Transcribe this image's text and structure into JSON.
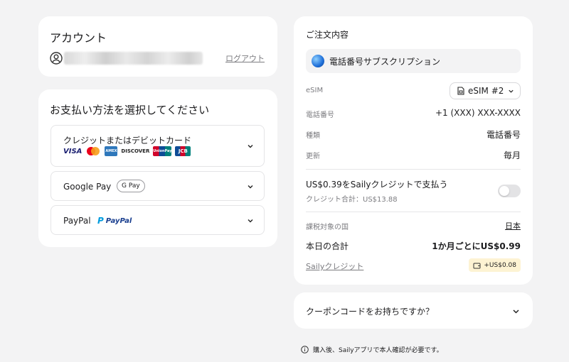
{
  "account": {
    "title": "アカウント",
    "logout": "ログアウト"
  },
  "payment": {
    "title": "お支払い方法を選択してください",
    "methods": [
      {
        "label": "クレジットまたはデビットカード",
        "logos": [
          "VISA",
          "Mastercard",
          "AMEX",
          "DISCOVER",
          "UnionPay",
          "JCB"
        ]
      },
      {
        "label": "Google Pay",
        "badge": "G Pay"
      },
      {
        "label": "PayPal",
        "brand": "PayPal"
      }
    ]
  },
  "order": {
    "title": "ご注文内容",
    "product": "電話番号サブスクリプション",
    "esim_label": "eSIM",
    "esim_value": "eSIM #2",
    "phone_label": "電話番号",
    "phone_value": "+1 (XXX) XXX-XXXX",
    "type_label": "種類",
    "type_value": "電話番号",
    "renew_label": "更新",
    "renew_value": "毎月",
    "credit_pay_title": "US$0.39をSailyクレジットで支払う",
    "credit_total": "クレジット合計：US$13.88",
    "tax_country_label": "課税対象の国",
    "tax_country_value": "日本",
    "total_label": "本日の合計",
    "total_value": "1か月ごとにUS$0.99",
    "saily_credit_label": "Sailyクレジット",
    "saily_credit_value": "+US$0.08"
  },
  "coupon": {
    "label": "クーポンコードをお持ちですか？"
  },
  "note": "購入後、Sailyアプリで本人確認が必要です。",
  "colors": {
    "background": "#f3f3f4",
    "card": "#ffffff",
    "credit_badge": "#fdf3d3",
    "toggle_off": "#e3e3e5"
  }
}
